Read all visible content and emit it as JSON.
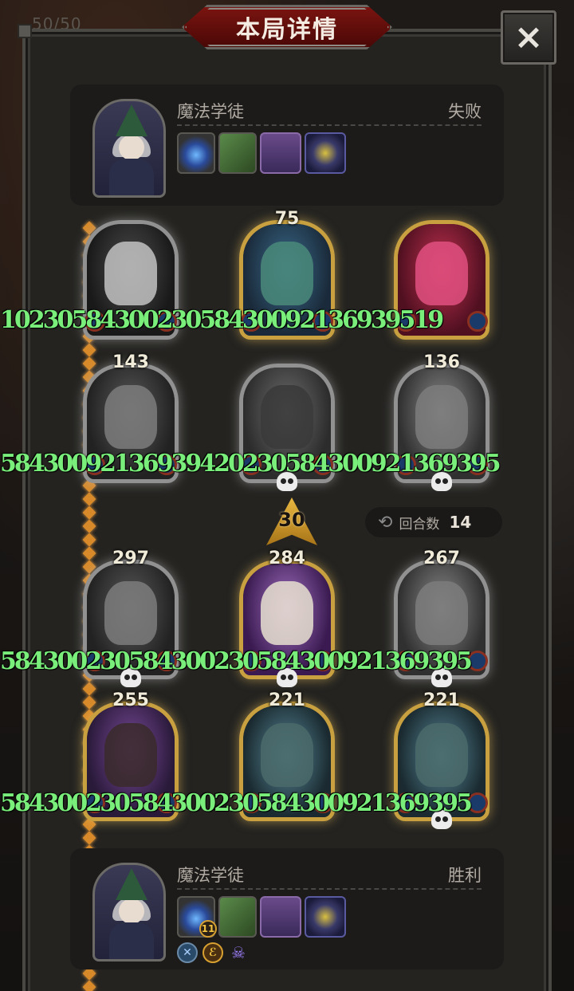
{
  "background": {
    "top_counter": "50/50"
  },
  "dialog": {
    "title": "本局详情",
    "close_icon": "×"
  },
  "players": {
    "top": {
      "name": "魔法学徒",
      "result": "失败",
      "items": [
        "orb",
        "book",
        "card-feast",
        "card-fireworks"
      ]
    },
    "bottom": {
      "name": "魔法学徒",
      "result": "胜利",
      "items": [
        "orb",
        "book",
        "card-feast",
        "card-fireworks"
      ],
      "item_badge": "11",
      "status_icons": [
        "crossed-swords-icon",
        "gold-coin-icon",
        "purple-skull-icon"
      ]
    }
  },
  "round": {
    "current": "30",
    "counter_label": "回合数",
    "counter_value": "14"
  },
  "cards": [
    {
      "hp": "",
      "art": "ghost",
      "skull": false
    },
    {
      "hp": "75",
      "art": "octo",
      "skull": false
    },
    {
      "hp": "",
      "art": "jester",
      "skull": false
    },
    {
      "hp": "143",
      "art": "demon",
      "skull": false
    },
    {
      "hp": "",
      "art": "owl",
      "skull": true
    },
    {
      "hp": "136",
      "art": "dragon",
      "skull": true
    },
    {
      "hp": "297",
      "art": "demon",
      "skull": true
    },
    {
      "hp": "284",
      "art": "skull",
      "skull": true
    },
    {
      "hp": "267",
      "art": "dragon",
      "skull": true
    },
    {
      "hp": "255",
      "art": "hood",
      "skull": false
    },
    {
      "hp": "221",
      "art": "fish",
      "skull": false
    },
    {
      "hp": "221",
      "art": "fish",
      "skull": true
    }
  ],
  "damage_strips": [
    "1023058430023058430092136939519",
    "58430092136939420230584300921369395",
    "584300230584300230584300921369395",
    "584300230584300230584300921369395"
  ],
  "colors": {
    "accent_gold": "#c8a040",
    "damage_green": "#7aee7a",
    "title_red": "#7a1410"
  }
}
